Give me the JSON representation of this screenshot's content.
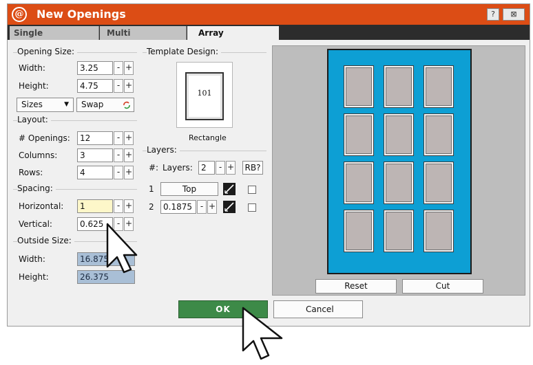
{
  "window": {
    "title": "New Openings",
    "logo_letter": "@",
    "help_label": "?",
    "close_label": "⊠"
  },
  "tabs": [
    {
      "label": "Single",
      "active": false
    },
    {
      "label": "Multi",
      "active": false
    },
    {
      "label": "Array",
      "active": true
    }
  ],
  "opening_size": {
    "group_label": "Opening Size:",
    "width_label": "Width:",
    "width_value": "3.25",
    "height_label": "Height:",
    "height_value": "4.75",
    "sizes_label": "Sizes",
    "swap_label": "Swap"
  },
  "layout": {
    "group_label": "Layout:",
    "openings_label": "# Openings:",
    "openings_value": "12",
    "columns_label": "Columns:",
    "columns_value": "3",
    "rows_label": "Rows:",
    "rows_value": "4"
  },
  "spacing": {
    "group_label": "Spacing:",
    "horizontal_label": "Horizontal:",
    "horizontal_value": "1",
    "vertical_label": "Vertical:",
    "vertical_value": "0.625"
  },
  "outside_size": {
    "group_label": "Outside Size:",
    "width_label": "Width:",
    "width_value": "16.875",
    "height_label": "Height:",
    "height_value": "26.375"
  },
  "template": {
    "group_label": "Template Design:",
    "number": "101",
    "name": "Rectangle"
  },
  "layers": {
    "group_label": "Layers:",
    "count_prefix": "#:",
    "count_label": "Layers:",
    "count_value": "2",
    "rb_label": "RB?",
    "rows": [
      {
        "index": "1",
        "value": "Top"
      },
      {
        "index": "2",
        "value": "0.1875"
      }
    ]
  },
  "stepper": {
    "minus": "-",
    "plus": "+"
  },
  "preview": {
    "reset_label": "Reset",
    "cut_label": "Cut",
    "frame_color": "#0d9fd4",
    "columns": 3,
    "rows": 4
  },
  "footer": {
    "ok_label": "OK",
    "cancel_label": "Cancel"
  },
  "colors": {
    "titlebar": "#dc4d15",
    "ok_button": "#3d8a48",
    "highlight_input": "#fdf7c9",
    "readonly_input": "#a9bfd6"
  }
}
